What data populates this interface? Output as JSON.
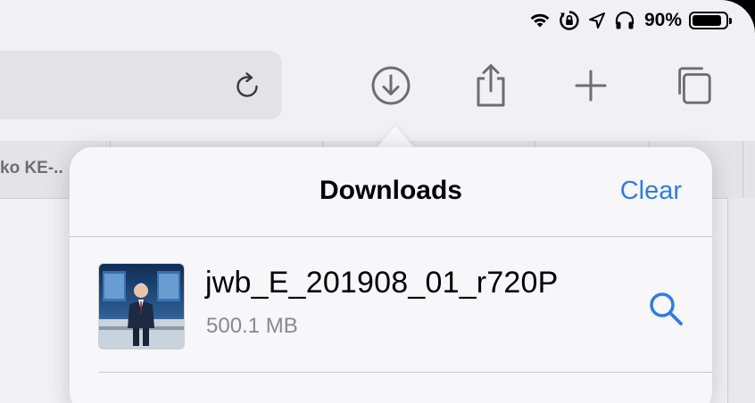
{
  "status": {
    "battery_pct": "90%",
    "battery_level": 0.9,
    "icons": [
      "wifi-icon",
      "rotation-lock-icon",
      "location-icon",
      "headphones-icon",
      "battery-icon"
    ]
  },
  "toolbar": {
    "icons": [
      "reload-icon",
      "downloads-icon",
      "share-icon",
      "new-tab-icon",
      "tabs-icon"
    ]
  },
  "tabs": {
    "visible_label": "ko KE-.."
  },
  "downloads": {
    "title": "Downloads",
    "clear_label": "Clear",
    "items": [
      {
        "name": "jwb_E_201908_01_r720P",
        "size": "500.1 MB"
      }
    ]
  },
  "colors": {
    "accent": "#2f7de0",
    "background": "#f1f1f3"
  }
}
